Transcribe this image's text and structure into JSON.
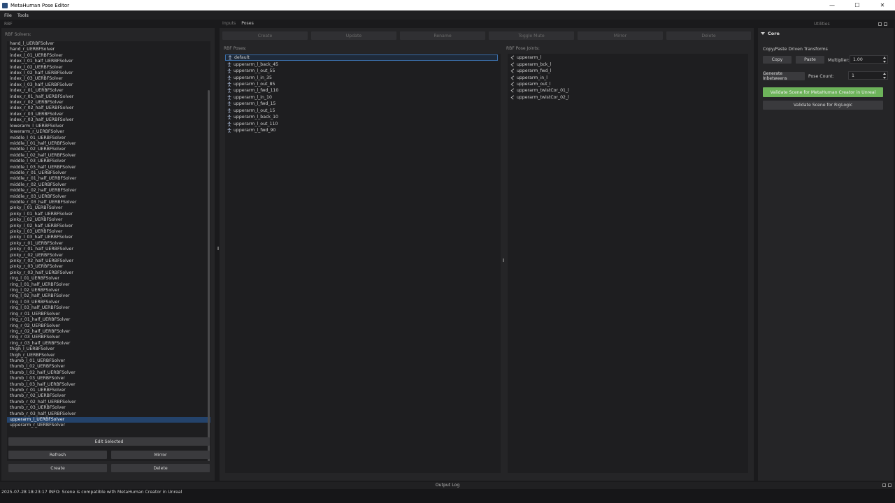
{
  "window": {
    "title": "MetaHuman Pose Editor"
  },
  "menu": [
    "File",
    "Tools"
  ],
  "left": {
    "dock_title": "RBF",
    "solvers_label": "RBF Solvers:",
    "solvers": [
      "hand_l_UERBFSolver",
      "hand_r_UERBFSolver",
      "index_l_01_UERBFSolver",
      "index_l_01_half_UERBFSolver",
      "index_l_02_UERBFSolver",
      "index_l_02_half_UERBFSolver",
      "index_l_03_UERBFSolver",
      "index_l_03_half_UERBFSolver",
      "index_r_01_UERBFSolver",
      "index_r_01_half_UERBFSolver",
      "index_r_02_UERBFSolver",
      "index_r_02_half_UERBFSolver",
      "index_r_03_UERBFSolver",
      "index_r_03_half_UERBFSolver",
      "lowerarm_l_UERBFSolver",
      "lowerarm_r_UERBFSolver",
      "middle_l_01_UERBFSolver",
      "middle_l_01_half_UERBFSolver",
      "middle_l_02_UERBFSolver",
      "middle_l_02_half_UERBFSolver",
      "middle_l_03_UERBFSolver",
      "middle_l_03_half_UERBFSolver",
      "middle_r_01_UERBFSolver",
      "middle_r_01_half_UERBFSolver",
      "middle_r_02_UERBFSolver",
      "middle_r_02_half_UERBFSolver",
      "middle_r_03_UERBFSolver",
      "middle_r_03_half_UERBFSolver",
      "pinky_l_01_UERBFSolver",
      "pinky_l_01_half_UERBFSolver",
      "pinky_l_02_UERBFSolver",
      "pinky_l_02_half_UERBFSolver",
      "pinky_l_03_UERBFSolver",
      "pinky_l_03_half_UERBFSolver",
      "pinky_r_01_UERBFSolver",
      "pinky_r_01_half_UERBFSolver",
      "pinky_r_02_UERBFSolver",
      "pinky_r_02_half_UERBFSolver",
      "pinky_r_03_UERBFSolver",
      "pinky_r_03_half_UERBFSolver",
      "ring_l_01_UERBFSolver",
      "ring_l_01_half_UERBFSolver",
      "ring_l_02_UERBFSolver",
      "ring_l_02_half_UERBFSolver",
      "ring_l_03_UERBFSolver",
      "ring_l_03_half_UERBFSolver",
      "ring_r_01_UERBFSolver",
      "ring_r_01_half_UERBFSolver",
      "ring_r_02_UERBFSolver",
      "ring_r_02_half_UERBFSolver",
      "ring_r_03_UERBFSolver",
      "ring_r_03_half_UERBFSolver",
      "thigh_l_UERBFSolver",
      "thigh_r_UERBFSolver",
      "thumb_l_01_UERBFSolver",
      "thumb_l_02_UERBFSolver",
      "thumb_l_02_half_UERBFSolver",
      "thumb_l_03_UERBFSolver",
      "thumb_l_03_half_UERBFSolver",
      "thumb_r_01_UERBFSolver",
      "thumb_r_02_UERBFSolver",
      "thumb_r_02_half_UERBFSolver",
      "thumb_r_03_UERBFSolver",
      "thumb_r_03_half_UERBFSolver",
      "upperarm_l_UERBFSolver",
      "upperarm_r_UERBFSolver"
    ],
    "selected_solver": "upperarm_l_UERBFSolver",
    "buttons": {
      "edit_selected": "Edit Selected",
      "refresh": "Refresh",
      "mirror": "Mirror",
      "create": "Create",
      "delete": "Delete"
    }
  },
  "center": {
    "tabs": [
      "Inputs",
      "Poses"
    ],
    "active_tab": "Poses",
    "toolbar": {
      "create": "Create",
      "update": "Update",
      "rename": "Rename",
      "toggle_mute": "Toggle Mute",
      "mirror": "Mirror",
      "delete": "Delete"
    },
    "poses_label": "RBF Poses:",
    "poses": [
      "default",
      "upperarm_l_back_45",
      "upperarm_l_out_55",
      "upperarm_l_in_35",
      "upperarm_l_out_85",
      "upperarm_l_fwd_110",
      "upperarm_l_in_10",
      "upperarm_l_fwd_15",
      "upperarm_l_out_15",
      "upperarm_l_back_10",
      "upperarm_l_out_110",
      "upperarm_l_fwd_90"
    ],
    "selected_pose": "default",
    "joints_label": "RBF Pose Joints:",
    "joints": [
      "upperarm_l",
      "upperarm_bck_l",
      "upperarm_fwd_l",
      "upperarm_in_l",
      "upperarm_out_l",
      "upperarm_twistCor_01_l",
      "upperarm_twistCor_02_l"
    ]
  },
  "right": {
    "dock_title": "Utilities",
    "section_title": "Core",
    "copy_paste_label": "Copy/Paste Driven Transforms",
    "copy_button": "Copy",
    "paste_button": "Paste",
    "multiplier_label": "Multiplier:",
    "multiplier_value": "1.00",
    "generate_button": "Generate Inbetweens",
    "pose_count_label": "Pose Count:",
    "pose_count_value": "1",
    "validate_metahuman_button": "Validate Scene for MetaHuman Creator in Unreal",
    "validate_riglogic_button": "Validate Scene for RigLogic",
    "accent_green": "#6db35a"
  },
  "output": {
    "title": "Output Log",
    "line": "2025-07-28 18:23:17 INFO: Scene is compatible with MetaHuman Creator in Unreal"
  }
}
